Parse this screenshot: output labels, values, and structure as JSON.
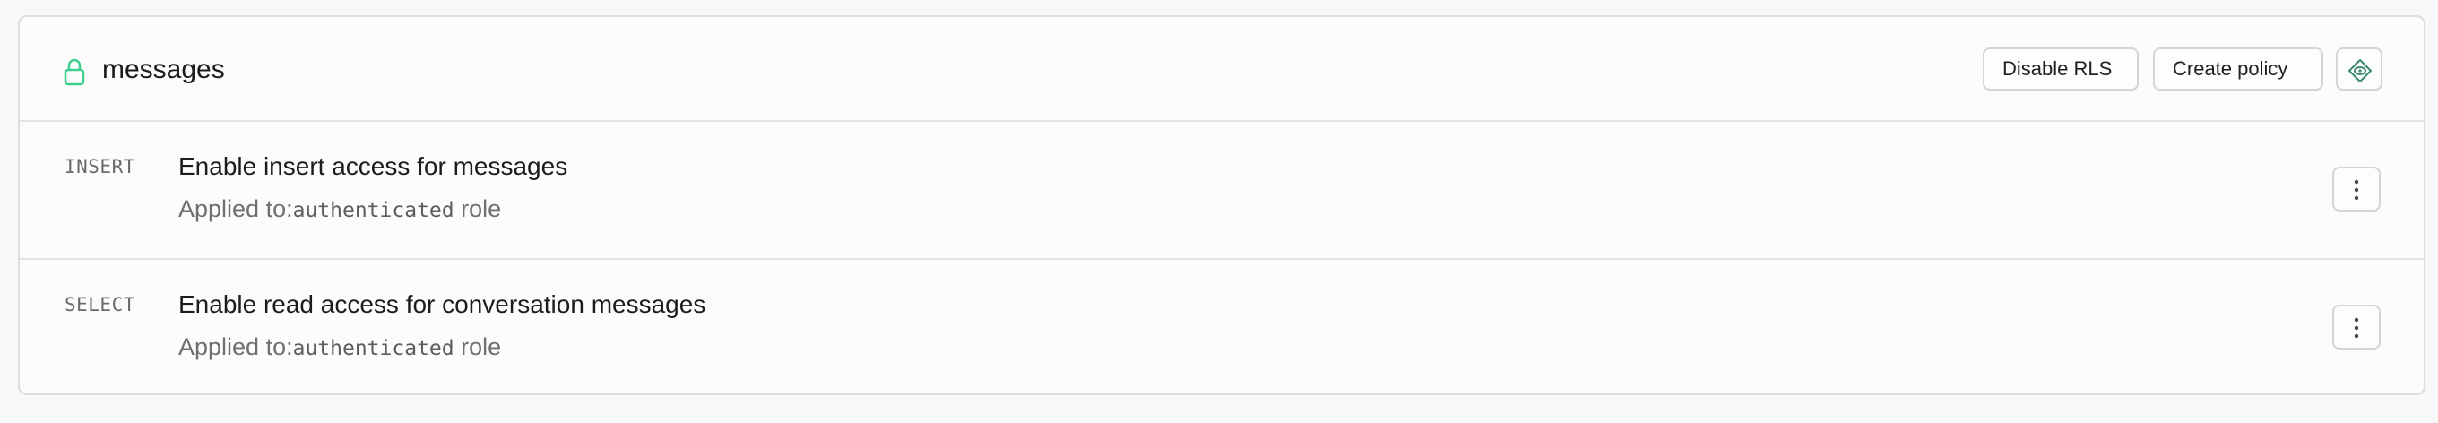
{
  "table": {
    "name": "messages",
    "lock_icon": "lock-icon",
    "lock_color": "#3ecf8e",
    "buttons": {
      "disable_rls": "Disable RLS",
      "create_policy": "Create policy",
      "extra_icon": "diamond-eye-icon"
    }
  },
  "policies": [
    {
      "command": "INSERT",
      "name": "Enable insert access for messages",
      "applied_prefix": "Applied to:",
      "role": "authenticated",
      "role_suffix": " role",
      "menu_icon": "more-vertical-icon"
    },
    {
      "command": "SELECT",
      "name": "Enable read access for conversation messages",
      "applied_prefix": "Applied to:",
      "role": "authenticated",
      "role_suffix": " role",
      "menu_icon": "more-vertical-icon"
    }
  ]
}
